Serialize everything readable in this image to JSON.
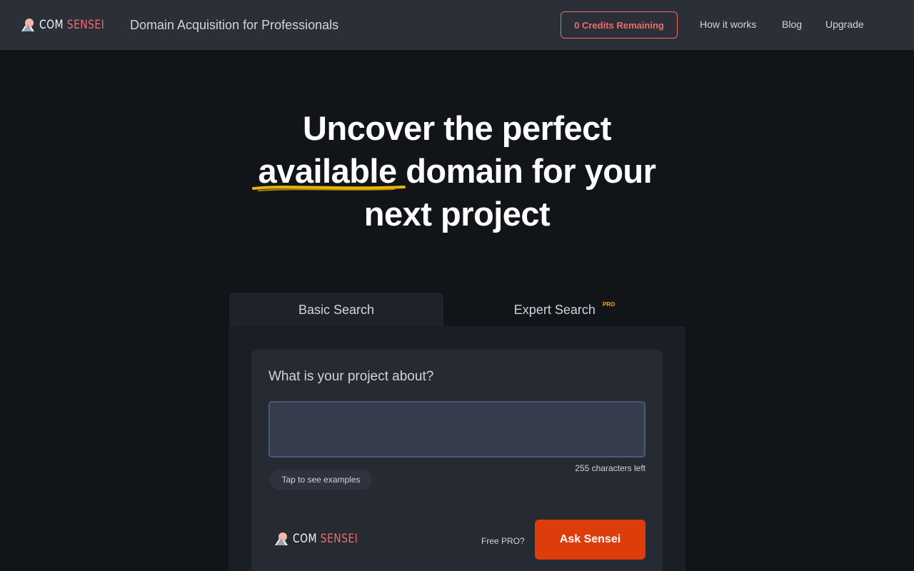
{
  "header": {
    "logo": {
      "com": "COM",
      "sensei": "SENSEI"
    },
    "tagline": "Domain Acquisition for Professionals",
    "credits_label": "0 Credits Remaining",
    "nav": [
      {
        "label": "How it works"
      },
      {
        "label": "Blog"
      },
      {
        "label": "Upgrade"
      }
    ]
  },
  "hero": {
    "line1": "Uncover the perfect",
    "highlight": "available",
    "line2_rest": "domain for your",
    "line3": "next project"
  },
  "tabs": [
    {
      "label": "Basic Search",
      "active": true
    },
    {
      "label": "Expert Search",
      "badge": "PRO",
      "active": false
    }
  ],
  "form": {
    "question": "What is your project about?",
    "input_value": "",
    "chars_left": "255 characters left",
    "examples_label": "Tap to see examples",
    "free_pro_label": "Free PRO?",
    "submit_label": "Ask Sensei"
  },
  "colors": {
    "accent": "#f06b6b",
    "submit": "#dc3d0b",
    "underline": "#eab308",
    "background": "#111419",
    "header": "#2a2f38"
  }
}
